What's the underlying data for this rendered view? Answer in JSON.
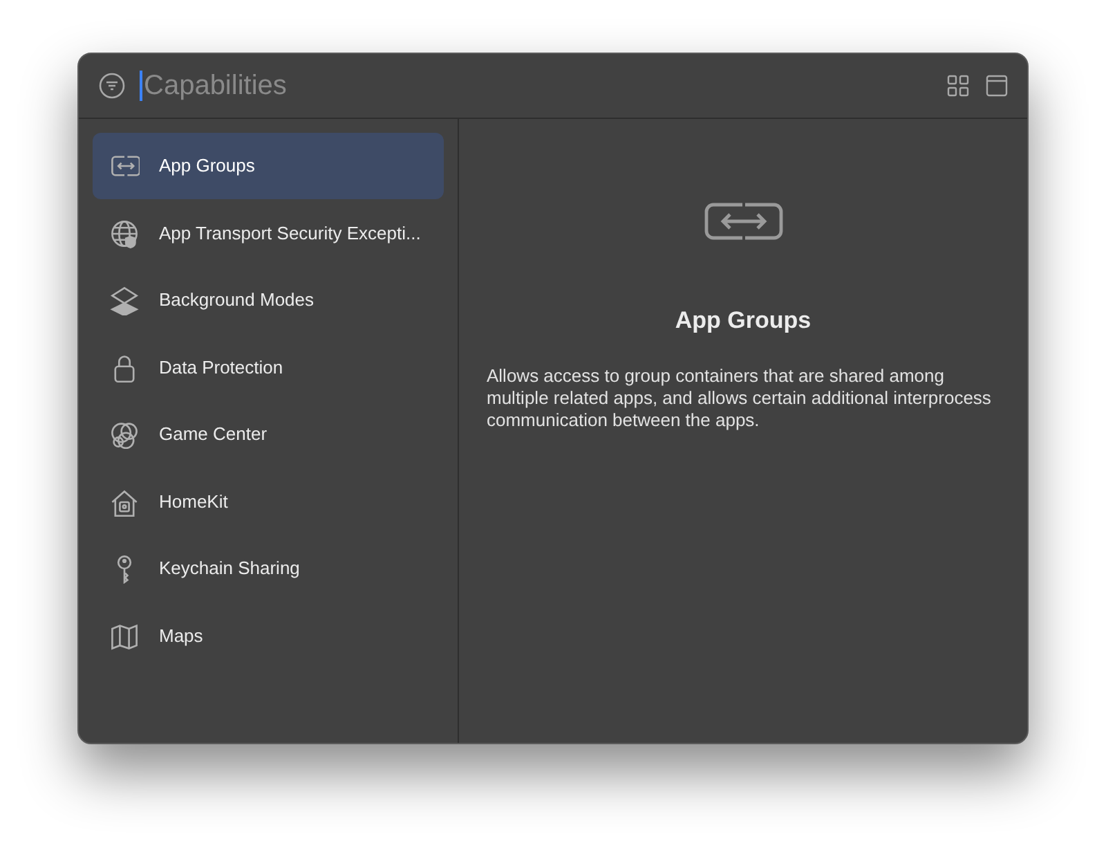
{
  "search": {
    "placeholder": "Capabilities"
  },
  "sidebar": {
    "items": [
      {
        "label": "App Groups",
        "selected": true
      },
      {
        "label": "App Transport Security Excepti...",
        "selected": false
      },
      {
        "label": "Background Modes",
        "selected": false
      },
      {
        "label": "Data Protection",
        "selected": false
      },
      {
        "label": "Game Center",
        "selected": false
      },
      {
        "label": "HomeKit",
        "selected": false
      },
      {
        "label": "Keychain Sharing",
        "selected": false
      },
      {
        "label": "Maps",
        "selected": false
      }
    ]
  },
  "detail": {
    "title": "App Groups",
    "description": "Allows access to group containers that are shared among multiple related apps, and allows certain additional interprocess communication between the apps."
  }
}
